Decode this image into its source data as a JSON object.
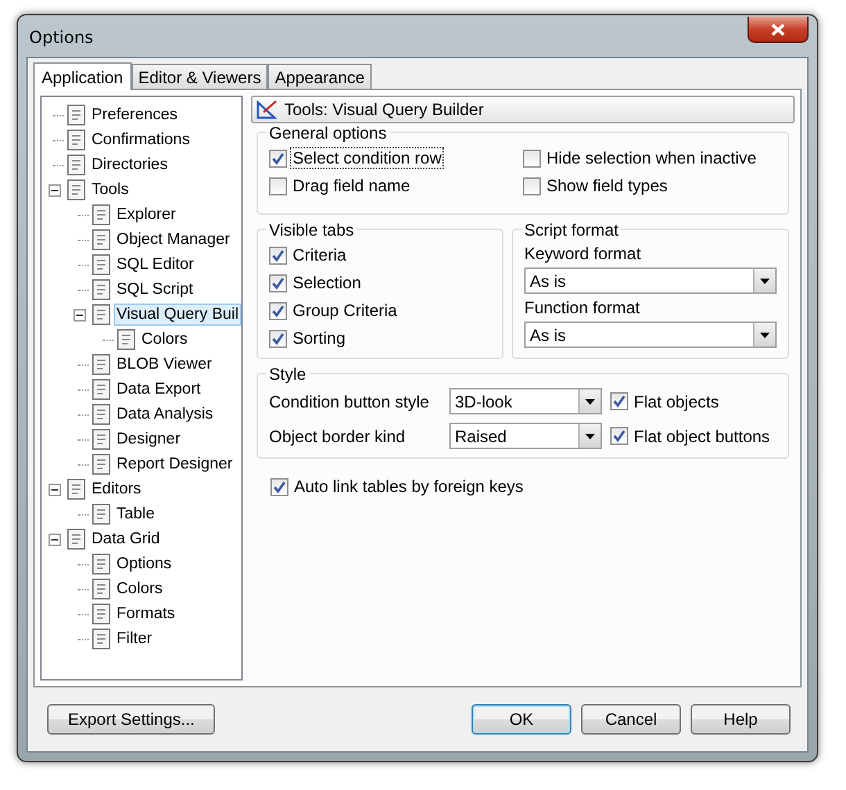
{
  "window": {
    "title": "Options"
  },
  "tabs": [
    {
      "label": "Application",
      "selected": true
    },
    {
      "label": "Editor & Viewers",
      "selected": false
    },
    {
      "label": "Appearance",
      "selected": false
    }
  ],
  "tree": [
    {
      "label": "Preferences",
      "selected": false
    },
    {
      "label": "Confirmations",
      "selected": false
    },
    {
      "label": "Directories",
      "selected": false
    },
    {
      "label": "Tools",
      "selected": false,
      "expanded": true,
      "children": [
        {
          "label": "Explorer",
          "selected": false
        },
        {
          "label": "Object Manager",
          "selected": false
        },
        {
          "label": "SQL Editor",
          "selected": false
        },
        {
          "label": "SQL Script",
          "selected": false
        },
        {
          "label": "Visual Query Buil",
          "selected": true,
          "expanded": true,
          "children": [
            {
              "label": "Colors",
              "selected": false
            }
          ]
        },
        {
          "label": "BLOB Viewer",
          "selected": false
        },
        {
          "label": "Data Export",
          "selected": false
        },
        {
          "label": "Data Analysis",
          "selected": false
        },
        {
          "label": "Designer",
          "selected": false
        },
        {
          "label": "Report Designer",
          "selected": false
        }
      ]
    },
    {
      "label": "Editors",
      "selected": false,
      "expanded": true,
      "children": [
        {
          "label": "Table",
          "selected": false
        }
      ]
    },
    {
      "label": "Data Grid",
      "selected": false,
      "expanded": true,
      "children": [
        {
          "label": "Options",
          "selected": false
        },
        {
          "label": "Colors",
          "selected": false
        },
        {
          "label": "Formats",
          "selected": false
        },
        {
          "label": "Filter",
          "selected": false
        }
      ]
    }
  ],
  "header": {
    "title": "Tools: Visual Query Builder"
  },
  "general_options": {
    "title": "General options",
    "options": [
      {
        "label": "Select condition row",
        "checked": true,
        "focused": true
      },
      {
        "label": "Hide selection when inactive",
        "checked": false,
        "focused": false
      },
      {
        "label": "Drag field name",
        "checked": false,
        "focused": false
      },
      {
        "label": "Show field types",
        "checked": false,
        "focused": false
      }
    ]
  },
  "visible_tabs": {
    "title": "Visible tabs",
    "options": [
      {
        "label": "Criteria",
        "checked": true
      },
      {
        "label": "Selection",
        "checked": true
      },
      {
        "label": "Group Criteria",
        "checked": true
      },
      {
        "label": "Sorting",
        "checked": true
      }
    ]
  },
  "script_format": {
    "title": "Script format",
    "fields": [
      {
        "label": "Keyword format",
        "value": "As is"
      },
      {
        "label": "Function format",
        "value": "As is"
      }
    ]
  },
  "style": {
    "title": "Style",
    "fields": [
      {
        "label": "Condition button style",
        "value": "3D-look"
      },
      {
        "label": "Object border kind",
        "value": "Raised"
      }
    ],
    "options": [
      {
        "label": "Flat objects",
        "checked": true
      },
      {
        "label": "Flat object buttons",
        "checked": true
      }
    ]
  },
  "auto_link": {
    "label": "Auto link tables by foreign keys",
    "checked": true
  },
  "footer": {
    "left": [
      {
        "label": "Export Settings...",
        "default": false
      }
    ],
    "right": [
      {
        "label": "OK",
        "default": true
      },
      {
        "label": "Cancel",
        "default": false
      },
      {
        "label": "Help",
        "default": false
      }
    ]
  }
}
